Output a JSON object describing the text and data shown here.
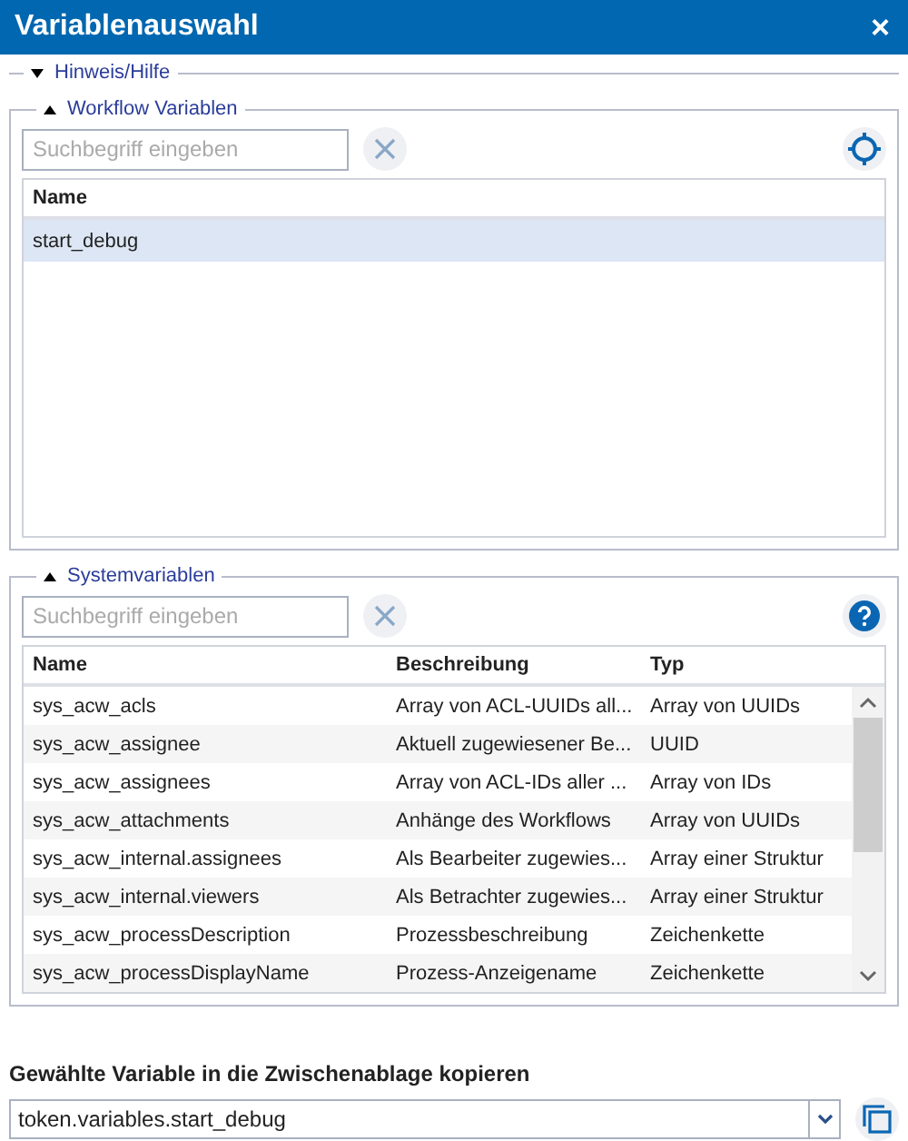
{
  "window": {
    "title": "Variablenauswahl",
    "close": "×"
  },
  "sections": [
    {
      "kind": "help",
      "title": "Hinweis/Hilfe",
      "expanded": false
    },
    {
      "kind": "workflow",
      "title": "Workflow Variablen",
      "expanded": true,
      "search": {
        "placeholder": "Suchbegriff eingeben"
      },
      "table": {
        "columns": [
          "Name"
        ],
        "rows": [
          {
            "cells": [
              "start_debug"
            ],
            "selected": true
          }
        ]
      }
    },
    {
      "kind": "system",
      "title": "Systemvariablen",
      "expanded": true,
      "search": {
        "placeholder": "Suchbegriff eingeben"
      },
      "table": {
        "columns": [
          "Name",
          "Beschreibung",
          "Typ"
        ],
        "rows": [
          {
            "cells": [
              "sys_acw_acls",
              "Array von ACL-UUIDs all...",
              "Array von UUIDs"
            ],
            "selected": false
          },
          {
            "cells": [
              "sys_acw_assignee",
              "Aktuell zugewiesener Be...",
              "UUID"
            ],
            "selected": false
          },
          {
            "cells": [
              "sys_acw_assignees",
              "Array von ACL-IDs aller ...",
              "Array von IDs"
            ],
            "selected": false
          },
          {
            "cells": [
              "sys_acw_attachments",
              "Anhänge des Workflows",
              "Array von UUIDs"
            ],
            "selected": false
          },
          {
            "cells": [
              "sys_acw_internal.assignees",
              "Als Bearbeiter zugewies...",
              "Array einer Struktur"
            ],
            "selected": false
          },
          {
            "cells": [
              "sys_acw_internal.viewers",
              "Als Betrachter zugewies...",
              "Array einer Struktur"
            ],
            "selected": false
          },
          {
            "cells": [
              "sys_acw_processDescription",
              "Prozessbeschreibung",
              "Zeichenkette"
            ],
            "selected": false
          },
          {
            "cells": [
              "sys_acw_processDisplayName",
              "Prozess-Anzeigename",
              "Zeichenkette"
            ],
            "selected": false
          }
        ]
      }
    }
  ],
  "copy": {
    "label": "Gewählte Variable in die Zwischenablage kopieren",
    "value": "token.variables.start_debug"
  }
}
